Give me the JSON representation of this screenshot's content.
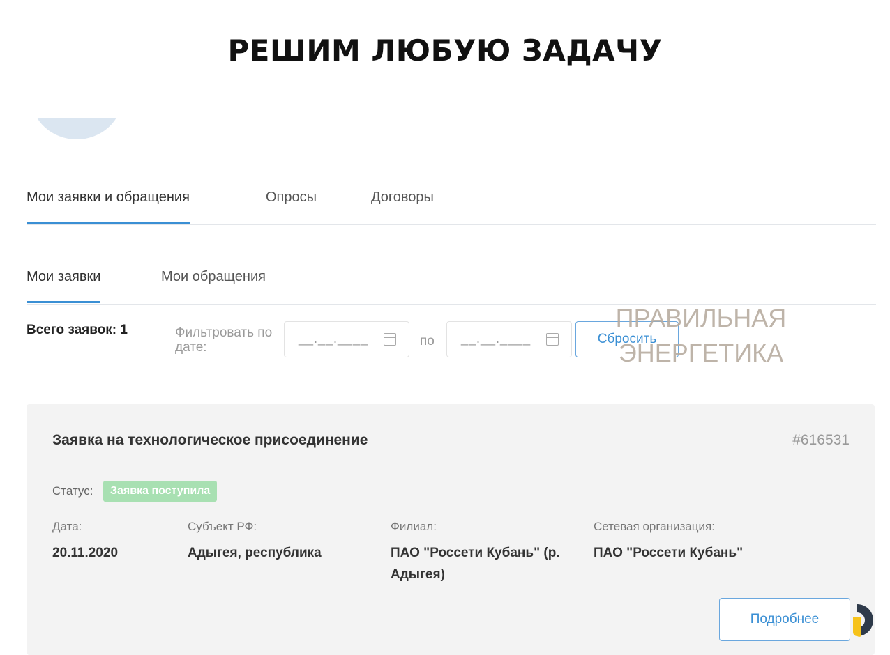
{
  "headline": "РЕШИМ ЛЮБУЮ ЗАДАЧУ",
  "tabs": [
    "Мои заявки и обращения",
    "Опросы",
    "Договоры"
  ],
  "subtabs": [
    "Мои заявки",
    "Мои обращения"
  ],
  "filter": {
    "total": "Всего заявок: 1",
    "label": "Фильтровать по дате:",
    "date_from_placeholder": "__.__.____",
    "separator": "по",
    "date_to_placeholder": "__.__.____",
    "reset_label": "Сбросить"
  },
  "watermark": "ПРАВИЛЬНАЯ ЭНЕРГЕТИКА",
  "card": {
    "title": "Заявка на технологическое присоединение",
    "number": "#616531",
    "status_label": "Статус:",
    "status_value": "Заявка поступила",
    "fields": [
      {
        "label": "Дата:",
        "value": "20.11.2020"
      },
      {
        "label": "Субъект РФ:",
        "value": "Адыгея, республика"
      },
      {
        "label": "Филиал:",
        "value": "ПАО \"Россети Кубань\" (р. Адыгея)"
      },
      {
        "label": "Сетевая организация:",
        "value": "ПАО \"Россети Кубань\""
      }
    ],
    "more_label": "Подробнее"
  },
  "colors": {
    "accent": "#3a8fd4",
    "status_badge": "#a8e0b2",
    "card_bg": "#f3f3f3",
    "logo_yellow": "#f6c21a",
    "logo_dark": "#2e3a4a"
  },
  "icons": [
    "calendar-icon",
    "brand-logo-icon"
  ]
}
